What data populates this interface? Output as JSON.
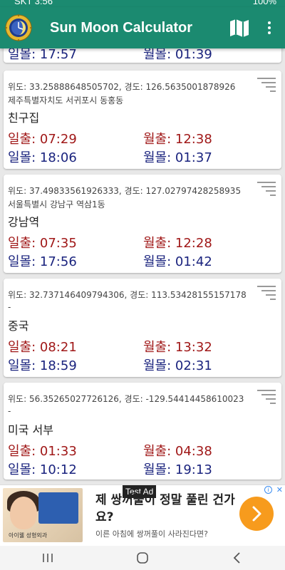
{
  "status": {
    "carrier_time": "SKT 3:56",
    "battery": "100%"
  },
  "app_bar": {
    "title": "Sun Moon Calculator"
  },
  "partial_card": {
    "moonset_label": "월몰: 01:39",
    "sunset_label": "일몰: 17:57"
  },
  "cards": [
    {
      "coords": "위도: 33.25888648505702, 경도: 126.5635001878926",
      "address": "제주특별자치도 서귀포시 동홍동",
      "name": "친구집",
      "sunrise": "일출: 07:29",
      "moonrise": "월출: 12:38",
      "sunset": "일몰: 18:06",
      "moonset": "월몰: 01:37"
    },
    {
      "coords": "위도: 37.49833561926333, 경도: 127.02797428258935",
      "address": "서울특별시 강남구 역삼1동",
      "name": "강남역",
      "sunrise": "일출: 07:35",
      "moonrise": "월출: 12:28",
      "sunset": "일몰: 17:56",
      "moonset": "월몰: 01:42"
    },
    {
      "coords": "위도: 32.737146409794306, 경도: 113.53428155157178",
      "address": "-",
      "name": "중국",
      "sunrise": "일출: 08:21",
      "moonrise": "월출: 13:32",
      "sunset": "일몰: 18:59",
      "moonset": "월몰: 02:31"
    },
    {
      "coords": "위도: 56.35265027726126, 경도: -129.54414458610023",
      "address": "-",
      "name": "미국 서부",
      "sunrise": "일출: 01:33",
      "moonrise": "월출: 04:38",
      "sunset": "일몰: 10:12",
      "moonset": "월몰: 19:13"
    }
  ],
  "ad": {
    "label": "Test Ad",
    "title": "제 쌍꺼풀이 정말 풀린 건가요?",
    "description": "이른 아침에 쌍꺼풀이 사라진다면?",
    "thumb_caption": "아이웰 성형외과"
  },
  "colors": {
    "primary": "#1b8a70",
    "sunrise": "#a01818",
    "sunset": "#1a237e",
    "cta": "#f79b1d"
  }
}
